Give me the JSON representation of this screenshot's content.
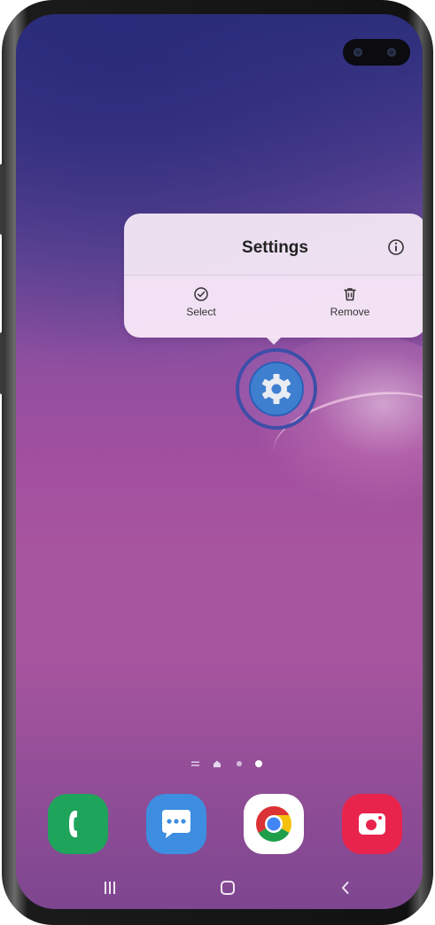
{
  "context_menu": {
    "title": "Settings",
    "info_icon": "info-icon",
    "actions": [
      {
        "label": "Select",
        "icon": "check-circle-icon"
      },
      {
        "label": "Remove",
        "icon": "trash-icon"
      }
    ]
  },
  "selected_app": {
    "icon": "gear-icon",
    "color": "#3f7fd0"
  },
  "page_indicator": {
    "pages": 3,
    "current": 3,
    "home_icon": "home-icon",
    "apps_icon": "menu-icon"
  },
  "dock": [
    {
      "icon": "phone-icon",
      "color": "#1fa45b"
    },
    {
      "icon": "messages-icon",
      "color": "#3d8de0"
    },
    {
      "icon": "chrome-icon",
      "color": "#ffffff"
    },
    {
      "icon": "camera-icon",
      "color": "#e8244d"
    }
  ],
  "nav_bar": [
    "recents-icon",
    "home-button-icon",
    "back-icon"
  ]
}
